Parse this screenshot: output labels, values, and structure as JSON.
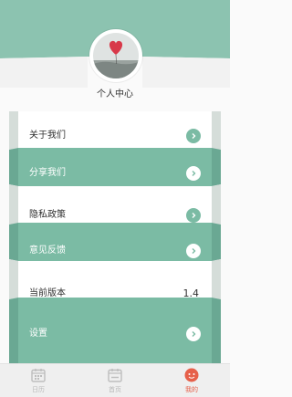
{
  "profile": {
    "title": "个人中心"
  },
  "menu": {
    "items": [
      {
        "label": "关于我们",
        "style": "white"
      },
      {
        "label": "分享我们",
        "style": "green"
      },
      {
        "label": "隐私政策",
        "style": "white"
      },
      {
        "label": "意见反馈",
        "style": "green"
      },
      {
        "label": "当前版本",
        "style": "white",
        "value": "1.4"
      },
      {
        "label": "设置",
        "style": "green"
      }
    ]
  },
  "tabbar": {
    "tabs": [
      {
        "label": "日历",
        "icon": "calendar-icon",
        "active": false
      },
      {
        "label": "首页",
        "icon": "calendar-home-icon",
        "active": false
      },
      {
        "label": "我的",
        "icon": "profile-face-icon",
        "active": true
      }
    ]
  },
  "colors": {
    "accent_green": "#7bbba4",
    "header_green": "#8cc3b0",
    "active_tab": "#e6604a",
    "inactive_tab": "#b8b8b8"
  }
}
